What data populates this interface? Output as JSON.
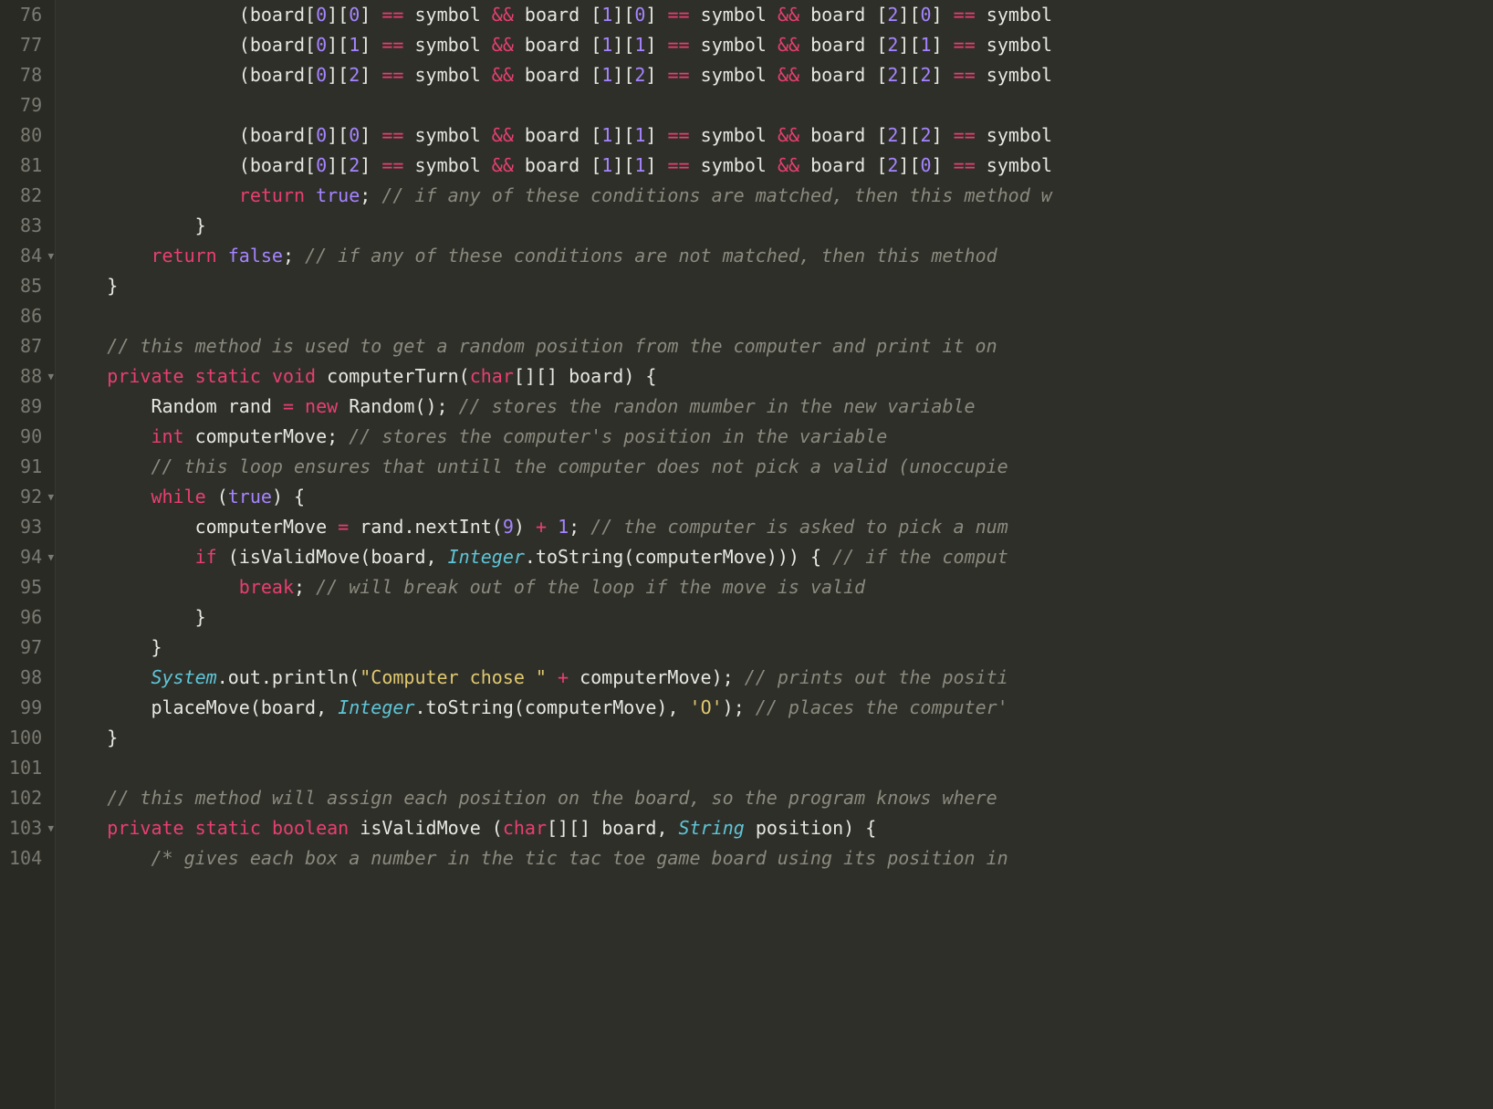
{
  "gutter": {
    "start": 76,
    "end": 104,
    "foldLines": [
      84,
      88,
      92,
      94,
      103
    ]
  },
  "lines": {
    "l76": {
      "indent": "                ",
      "tokens": [
        {
          "t": "paren",
          "v": "("
        },
        {
          "t": "ident",
          "v": "board"
        },
        {
          "t": "paren",
          "v": "["
        },
        {
          "t": "num",
          "v": "0"
        },
        {
          "t": "paren",
          "v": "]["
        },
        {
          "t": "num",
          "v": "0"
        },
        {
          "t": "paren",
          "v": "] "
        },
        {
          "t": "op",
          "v": "=="
        },
        {
          "t": "ident",
          "v": " symbol "
        },
        {
          "t": "op",
          "v": "&&"
        },
        {
          "t": "ident",
          "v": " board "
        },
        {
          "t": "paren",
          "v": "["
        },
        {
          "t": "num",
          "v": "1"
        },
        {
          "t": "paren",
          "v": "]["
        },
        {
          "t": "num",
          "v": "0"
        },
        {
          "t": "paren",
          "v": "] "
        },
        {
          "t": "op",
          "v": "=="
        },
        {
          "t": "ident",
          "v": " symbol "
        },
        {
          "t": "op",
          "v": "&&"
        },
        {
          "t": "ident",
          "v": " board "
        },
        {
          "t": "paren",
          "v": "["
        },
        {
          "t": "num",
          "v": "2"
        },
        {
          "t": "paren",
          "v": "]["
        },
        {
          "t": "num",
          "v": "0"
        },
        {
          "t": "paren",
          "v": "] "
        },
        {
          "t": "op",
          "v": "=="
        },
        {
          "t": "ident",
          "v": " symbol"
        }
      ]
    },
    "l77": {
      "indent": "                ",
      "tokens": [
        {
          "t": "paren",
          "v": "("
        },
        {
          "t": "ident",
          "v": "board"
        },
        {
          "t": "paren",
          "v": "["
        },
        {
          "t": "num",
          "v": "0"
        },
        {
          "t": "paren",
          "v": "]["
        },
        {
          "t": "num",
          "v": "1"
        },
        {
          "t": "paren",
          "v": "] "
        },
        {
          "t": "op",
          "v": "=="
        },
        {
          "t": "ident",
          "v": " symbol "
        },
        {
          "t": "op",
          "v": "&&"
        },
        {
          "t": "ident",
          "v": " board "
        },
        {
          "t": "paren",
          "v": "["
        },
        {
          "t": "num",
          "v": "1"
        },
        {
          "t": "paren",
          "v": "]["
        },
        {
          "t": "num",
          "v": "1"
        },
        {
          "t": "paren",
          "v": "] "
        },
        {
          "t": "op",
          "v": "=="
        },
        {
          "t": "ident",
          "v": " symbol "
        },
        {
          "t": "op",
          "v": "&&"
        },
        {
          "t": "ident",
          "v": " board "
        },
        {
          "t": "paren",
          "v": "["
        },
        {
          "t": "num",
          "v": "2"
        },
        {
          "t": "paren",
          "v": "]["
        },
        {
          "t": "num",
          "v": "1"
        },
        {
          "t": "paren",
          "v": "] "
        },
        {
          "t": "op",
          "v": "=="
        },
        {
          "t": "ident",
          "v": " symbol"
        }
      ]
    },
    "l78": {
      "indent": "                ",
      "tokens": [
        {
          "t": "paren",
          "v": "("
        },
        {
          "t": "ident",
          "v": "board"
        },
        {
          "t": "paren",
          "v": "["
        },
        {
          "t": "num",
          "v": "0"
        },
        {
          "t": "paren",
          "v": "]["
        },
        {
          "t": "num",
          "v": "2"
        },
        {
          "t": "paren",
          "v": "] "
        },
        {
          "t": "op",
          "v": "=="
        },
        {
          "t": "ident",
          "v": " symbol "
        },
        {
          "t": "op",
          "v": "&&"
        },
        {
          "t": "ident",
          "v": " board "
        },
        {
          "t": "paren",
          "v": "["
        },
        {
          "t": "num",
          "v": "1"
        },
        {
          "t": "paren",
          "v": "]["
        },
        {
          "t": "num",
          "v": "2"
        },
        {
          "t": "paren",
          "v": "] "
        },
        {
          "t": "op",
          "v": "=="
        },
        {
          "t": "ident",
          "v": " symbol "
        },
        {
          "t": "op",
          "v": "&&"
        },
        {
          "t": "ident",
          "v": " board "
        },
        {
          "t": "paren",
          "v": "["
        },
        {
          "t": "num",
          "v": "2"
        },
        {
          "t": "paren",
          "v": "]["
        },
        {
          "t": "num",
          "v": "2"
        },
        {
          "t": "paren",
          "v": "] "
        },
        {
          "t": "op",
          "v": "=="
        },
        {
          "t": "ident",
          "v": " symbol"
        }
      ]
    },
    "l79": {
      "indent": "",
      "tokens": []
    },
    "l80": {
      "indent": "                ",
      "tokens": [
        {
          "t": "paren",
          "v": "("
        },
        {
          "t": "ident",
          "v": "board"
        },
        {
          "t": "paren",
          "v": "["
        },
        {
          "t": "num",
          "v": "0"
        },
        {
          "t": "paren",
          "v": "]["
        },
        {
          "t": "num",
          "v": "0"
        },
        {
          "t": "paren",
          "v": "] "
        },
        {
          "t": "op",
          "v": "=="
        },
        {
          "t": "ident",
          "v": " symbol "
        },
        {
          "t": "op",
          "v": "&&"
        },
        {
          "t": "ident",
          "v": " board "
        },
        {
          "t": "paren",
          "v": "["
        },
        {
          "t": "num",
          "v": "1"
        },
        {
          "t": "paren",
          "v": "]["
        },
        {
          "t": "num",
          "v": "1"
        },
        {
          "t": "paren",
          "v": "] "
        },
        {
          "t": "op",
          "v": "=="
        },
        {
          "t": "ident",
          "v": " symbol "
        },
        {
          "t": "op",
          "v": "&&"
        },
        {
          "t": "ident",
          "v": " board "
        },
        {
          "t": "paren",
          "v": "["
        },
        {
          "t": "num",
          "v": "2"
        },
        {
          "t": "paren",
          "v": "]["
        },
        {
          "t": "num",
          "v": "2"
        },
        {
          "t": "paren",
          "v": "] "
        },
        {
          "t": "op",
          "v": "=="
        },
        {
          "t": "ident",
          "v": " symbol"
        }
      ]
    },
    "l81": {
      "indent": "                ",
      "tokens": [
        {
          "t": "paren",
          "v": "("
        },
        {
          "t": "ident",
          "v": "board"
        },
        {
          "t": "paren",
          "v": "["
        },
        {
          "t": "num",
          "v": "0"
        },
        {
          "t": "paren",
          "v": "]["
        },
        {
          "t": "num",
          "v": "2"
        },
        {
          "t": "paren",
          "v": "] "
        },
        {
          "t": "op",
          "v": "=="
        },
        {
          "t": "ident",
          "v": " symbol "
        },
        {
          "t": "op",
          "v": "&&"
        },
        {
          "t": "ident",
          "v": " board "
        },
        {
          "t": "paren",
          "v": "["
        },
        {
          "t": "num",
          "v": "1"
        },
        {
          "t": "paren",
          "v": "]["
        },
        {
          "t": "num",
          "v": "1"
        },
        {
          "t": "paren",
          "v": "] "
        },
        {
          "t": "op",
          "v": "=="
        },
        {
          "t": "ident",
          "v": " symbol "
        },
        {
          "t": "op",
          "v": "&&"
        },
        {
          "t": "ident",
          "v": " board "
        },
        {
          "t": "paren",
          "v": "["
        },
        {
          "t": "num",
          "v": "2"
        },
        {
          "t": "paren",
          "v": "]["
        },
        {
          "t": "num",
          "v": "0"
        },
        {
          "t": "paren",
          "v": "] "
        },
        {
          "t": "op",
          "v": "=="
        },
        {
          "t": "ident",
          "v": " symbol"
        }
      ]
    },
    "l82": {
      "indent": "                ",
      "tokens": [
        {
          "t": "kw",
          "v": "return"
        },
        {
          "t": "ident",
          "v": " "
        },
        {
          "t": "bool",
          "v": "true"
        },
        {
          "t": "paren",
          "v": "; "
        },
        {
          "t": "comment",
          "v": "// if any of these conditions are matched, then this method w"
        }
      ]
    },
    "l83": {
      "indent": "            ",
      "tokens": [
        {
          "t": "paren",
          "v": "}"
        }
      ]
    },
    "l84": {
      "indent": "        ",
      "tokens": [
        {
          "t": "kw",
          "v": "return"
        },
        {
          "t": "ident",
          "v": " "
        },
        {
          "t": "bool",
          "v": "false"
        },
        {
          "t": "paren",
          "v": "; "
        },
        {
          "t": "comment",
          "v": "// if any of these conditions are not matched, then this method "
        }
      ]
    },
    "l85": {
      "indent": "    ",
      "tokens": [
        {
          "t": "paren",
          "v": "}"
        }
      ]
    },
    "l86": {
      "indent": "",
      "tokens": []
    },
    "l87": {
      "indent": "    ",
      "tokens": [
        {
          "t": "comment",
          "v": "// this method is used to get a random position from the computer and print it on "
        }
      ]
    },
    "l88": {
      "indent": "    ",
      "tokens": [
        {
          "t": "kw",
          "v": "private"
        },
        {
          "t": "ident",
          "v": " "
        },
        {
          "t": "kw",
          "v": "static"
        },
        {
          "t": "ident",
          "v": " "
        },
        {
          "t": "kw",
          "v": "void"
        },
        {
          "t": "ident",
          "v": " "
        },
        {
          "t": "fn",
          "v": "computerTurn"
        },
        {
          "t": "paren",
          "v": "("
        },
        {
          "t": "kw",
          "v": "char"
        },
        {
          "t": "paren",
          "v": "[][] "
        },
        {
          "t": "ident",
          "v": "board"
        },
        {
          "t": "paren",
          "v": ") {"
        }
      ]
    },
    "l89": {
      "indent": "        ",
      "tokens": [
        {
          "t": "ident",
          "v": "Random rand "
        },
        {
          "t": "op",
          "v": "="
        },
        {
          "t": "ident",
          "v": " "
        },
        {
          "t": "kw",
          "v": "new"
        },
        {
          "t": "ident",
          "v": " "
        },
        {
          "t": "fn",
          "v": "Random"
        },
        {
          "t": "paren",
          "v": "(); "
        },
        {
          "t": "comment",
          "v": "// stores the randon mumber in the new variable"
        }
      ]
    },
    "l90": {
      "indent": "        ",
      "tokens": [
        {
          "t": "kw",
          "v": "int"
        },
        {
          "t": "ident",
          "v": " computerMove"
        },
        {
          "t": "paren",
          "v": "; "
        },
        {
          "t": "comment",
          "v": "// stores the computer's position in the variable"
        }
      ]
    },
    "l91": {
      "indent": "        ",
      "tokens": [
        {
          "t": "comment",
          "v": "// this loop ensures that untill the computer does not pick a valid (unoccupie"
        }
      ]
    },
    "l92": {
      "indent": "        ",
      "tokens": [
        {
          "t": "kw",
          "v": "while"
        },
        {
          "t": "ident",
          "v": " "
        },
        {
          "t": "paren",
          "v": "("
        },
        {
          "t": "bool",
          "v": "true"
        },
        {
          "t": "paren",
          "v": ") {"
        }
      ]
    },
    "l93": {
      "indent": "            ",
      "tokens": [
        {
          "t": "ident",
          "v": "computerMove "
        },
        {
          "t": "op",
          "v": "="
        },
        {
          "t": "ident",
          "v": " rand"
        },
        {
          "t": "paren",
          "v": "."
        },
        {
          "t": "fn",
          "v": "nextInt"
        },
        {
          "t": "paren",
          "v": "("
        },
        {
          "t": "num",
          "v": "9"
        },
        {
          "t": "paren",
          "v": ") "
        },
        {
          "t": "op",
          "v": "+"
        },
        {
          "t": "ident",
          "v": " "
        },
        {
          "t": "num",
          "v": "1"
        },
        {
          "t": "paren",
          "v": "; "
        },
        {
          "t": "comment",
          "v": "// the computer is asked to pick a num"
        }
      ]
    },
    "l94": {
      "indent": "            ",
      "tokens": [
        {
          "t": "kw",
          "v": "if"
        },
        {
          "t": "ident",
          "v": " "
        },
        {
          "t": "paren",
          "v": "("
        },
        {
          "t": "fn",
          "v": "isValidMove"
        },
        {
          "t": "paren",
          "v": "("
        },
        {
          "t": "ident",
          "v": "board"
        },
        {
          "t": "paren",
          "v": ", "
        },
        {
          "t": "type",
          "v": "Integer"
        },
        {
          "t": "paren",
          "v": "."
        },
        {
          "t": "fn",
          "v": "toString"
        },
        {
          "t": "paren",
          "v": "("
        },
        {
          "t": "ident",
          "v": "computerMove"
        },
        {
          "t": "paren",
          "v": "))) { "
        },
        {
          "t": "comment",
          "v": "// if the comput"
        }
      ]
    },
    "l95": {
      "indent": "                ",
      "tokens": [
        {
          "t": "kw",
          "v": "break"
        },
        {
          "t": "paren",
          "v": "; "
        },
        {
          "t": "comment",
          "v": "// will break out of the loop if the move is valid"
        }
      ]
    },
    "l96": {
      "indent": "            ",
      "tokens": [
        {
          "t": "paren",
          "v": "}"
        }
      ]
    },
    "l97": {
      "indent": "        ",
      "tokens": [
        {
          "t": "paren",
          "v": "}"
        }
      ]
    },
    "l98": {
      "indent": "        ",
      "tokens": [
        {
          "t": "type",
          "v": "System"
        },
        {
          "t": "paren",
          "v": "."
        },
        {
          "t": "ident",
          "v": "out"
        },
        {
          "t": "paren",
          "v": "."
        },
        {
          "t": "fn",
          "v": "println"
        },
        {
          "t": "paren",
          "v": "("
        },
        {
          "t": "str",
          "v": "\"Computer chose \""
        },
        {
          "t": "ident",
          "v": " "
        },
        {
          "t": "op",
          "v": "+"
        },
        {
          "t": "ident",
          "v": " computerMove"
        },
        {
          "t": "paren",
          "v": "); "
        },
        {
          "t": "comment",
          "v": "// prints out the positi"
        }
      ]
    },
    "l99": {
      "indent": "        ",
      "tokens": [
        {
          "t": "fn",
          "v": "placeMove"
        },
        {
          "t": "paren",
          "v": "("
        },
        {
          "t": "ident",
          "v": "board"
        },
        {
          "t": "paren",
          "v": ", "
        },
        {
          "t": "type",
          "v": "Integer"
        },
        {
          "t": "paren",
          "v": "."
        },
        {
          "t": "fn",
          "v": "toString"
        },
        {
          "t": "paren",
          "v": "("
        },
        {
          "t": "ident",
          "v": "computerMove"
        },
        {
          "t": "paren",
          "v": "), "
        },
        {
          "t": "str",
          "v": "'O'"
        },
        {
          "t": "paren",
          "v": "); "
        },
        {
          "t": "comment",
          "v": "// places the computer'"
        }
      ]
    },
    "l100": {
      "indent": "    ",
      "tokens": [
        {
          "t": "paren",
          "v": "}"
        }
      ]
    },
    "l101": {
      "indent": "",
      "tokens": []
    },
    "l102": {
      "indent": "    ",
      "tokens": [
        {
          "t": "comment",
          "v": "// this method will assign each position on the board, so the program knows where "
        }
      ]
    },
    "l103": {
      "indent": "    ",
      "tokens": [
        {
          "t": "kw",
          "v": "private"
        },
        {
          "t": "ident",
          "v": " "
        },
        {
          "t": "kw",
          "v": "static"
        },
        {
          "t": "ident",
          "v": " "
        },
        {
          "t": "kw",
          "v": "boolean"
        },
        {
          "t": "ident",
          "v": " "
        },
        {
          "t": "fn",
          "v": "isValidMove"
        },
        {
          "t": "ident",
          "v": " "
        },
        {
          "t": "paren",
          "v": "("
        },
        {
          "t": "kw",
          "v": "char"
        },
        {
          "t": "paren",
          "v": "[][] "
        },
        {
          "t": "ident",
          "v": "board"
        },
        {
          "t": "paren",
          "v": ", "
        },
        {
          "t": "type",
          "v": "String"
        },
        {
          "t": "ident",
          "v": " position"
        },
        {
          "t": "paren",
          "v": ") {"
        }
      ]
    },
    "l104": {
      "indent": "        ",
      "tokens": [
        {
          "t": "comment",
          "v": "/* gives each box a number in the tic tac toe game board using its position in"
        }
      ]
    }
  }
}
